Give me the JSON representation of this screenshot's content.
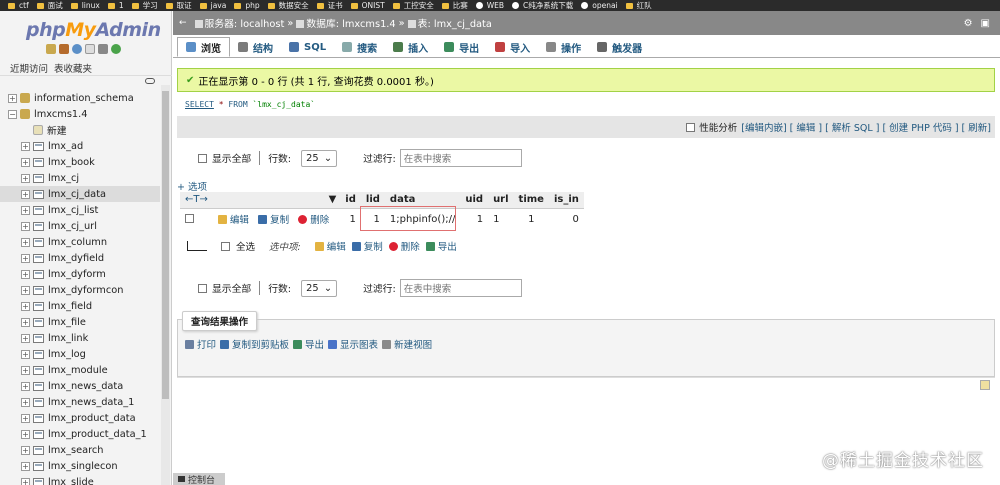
{
  "bookmarks": [
    "ctf",
    "面试",
    "linux",
    "1",
    "学习",
    "取证",
    "java",
    "php",
    "数据安全",
    "证书",
    "ONIST",
    "工控安全",
    "比赛",
    "WEB",
    "C纯净系统下载",
    "openai",
    "红队"
  ],
  "navigation": {
    "logo_php": "php",
    "logo_my": "My",
    "logo_admin": "Admin",
    "recent_label": "近期访问",
    "favorites_label": "表收藏夹",
    "tree": [
      {
        "label": "information_schema",
        "type": "db",
        "expander": "+"
      },
      {
        "label": "lmxcms1.4",
        "type": "db",
        "expander": "−"
      },
      {
        "label": "新建",
        "type": "new",
        "expander": ""
      },
      {
        "label": "lmx_ad",
        "type": "table",
        "expander": "+"
      },
      {
        "label": "lmx_book",
        "type": "table",
        "expander": "+"
      },
      {
        "label": "lmx_cj",
        "type": "table",
        "expander": "+"
      },
      {
        "label": "lmx_cj_data",
        "type": "table",
        "expander": "+",
        "active": true
      },
      {
        "label": "lmx_cj_list",
        "type": "table",
        "expander": "+"
      },
      {
        "label": "lmx_cj_url",
        "type": "table",
        "expander": "+"
      },
      {
        "label": "lmx_column",
        "type": "table",
        "expander": "+"
      },
      {
        "label": "lmx_dyfield",
        "type": "table",
        "expander": "+"
      },
      {
        "label": "lmx_dyform",
        "type": "table",
        "expander": "+"
      },
      {
        "label": "lmx_dyformcon",
        "type": "table",
        "expander": "+"
      },
      {
        "label": "lmx_field",
        "type": "table",
        "expander": "+"
      },
      {
        "label": "lmx_file",
        "type": "table",
        "expander": "+"
      },
      {
        "label": "lmx_link",
        "type": "table",
        "expander": "+"
      },
      {
        "label": "lmx_log",
        "type": "table",
        "expander": "+"
      },
      {
        "label": "lmx_module",
        "type": "table",
        "expander": "+"
      },
      {
        "label": "lmx_news_data",
        "type": "table",
        "expander": "+"
      },
      {
        "label": "lmx_news_data_1",
        "type": "table",
        "expander": "+"
      },
      {
        "label": "lmx_product_data",
        "type": "table",
        "expander": "+"
      },
      {
        "label": "lmx_product_data_1",
        "type": "table",
        "expander": "+"
      },
      {
        "label": "lmx_search",
        "type": "table",
        "expander": "+"
      },
      {
        "label": "lmx_singlecon",
        "type": "table",
        "expander": "+"
      },
      {
        "label": "lmx_slide",
        "type": "table",
        "expander": "+"
      }
    ]
  },
  "breadcrumb": {
    "server": "服务器: localhost",
    "database": "数据库: lmxcms1.4",
    "table": "表: lmx_cj_data",
    "sep": "»"
  },
  "tabs": [
    {
      "label": "浏览",
      "active": true,
      "color": "#5b8fc7"
    },
    {
      "label": "结构",
      "color": "#7b7b7b"
    },
    {
      "label": "SQL",
      "color": "#4a73a8"
    },
    {
      "label": "搜索",
      "color": "#8aa"
    },
    {
      "label": "插入",
      "color": "#4c7c4c"
    },
    {
      "label": "导出",
      "color": "#3c8c5c"
    },
    {
      "label": "导入",
      "color": "#c04040"
    },
    {
      "label": "操作",
      "color": "#888"
    },
    {
      "label": "触发器",
      "color": "#666"
    }
  ],
  "success": {
    "check": "✔",
    "message": "正在显示第 0 - 0 行 (共 1 行, 查询花费 0.0001 秒。)"
  },
  "sql": {
    "select": "SELECT",
    "star": "*",
    "from": "FROM",
    "table": "`lmx_cj_data`"
  },
  "query_tools": {
    "profiling": "性能分析",
    "links": "[编辑内嵌] [ 编辑 ] [ 解析 SQL ] [ 创建 PHP 代码 ] [ 刷新]"
  },
  "nav_controls": {
    "show_all": "显示全部",
    "rows_label": "行数:",
    "rows_value": "25",
    "filter_label": "过滤行:",
    "filter_placeholder": "在表中搜索"
  },
  "options_link": "+ 选项",
  "results": {
    "arrows": "←T→",
    "columns": [
      "id",
      "lid",
      "data",
      "uid",
      "url",
      "time",
      "is_in"
    ],
    "rows": [
      {
        "id": "1",
        "lid": "1",
        "data": "1;phpinfo();//",
        "uid": "1",
        "url": "1",
        "time": "1",
        "is_in": "0"
      }
    ],
    "row_actions": {
      "edit": "编辑",
      "copy": "复制",
      "delete": "删除"
    }
  },
  "bulk": {
    "select_all": "全选",
    "selected_label": "选中项:",
    "edit": "编辑",
    "copy": "复制",
    "delete": "删除",
    "export": "导出"
  },
  "query_results_ops": {
    "legend": "查询结果操作",
    "print": "打印",
    "copy_clipboard": "复制到剪贴板",
    "export": "导出",
    "show_chart": "显示图表",
    "create_view": "新建视图"
  },
  "console": "控制台",
  "watermark": "@稀土掘金技术社区",
  "colors": {
    "success_bg": "#ebf8a4",
    "success_border": "#a2d246",
    "link": "#235a81",
    "breadcrumb_bg": "#888888"
  }
}
